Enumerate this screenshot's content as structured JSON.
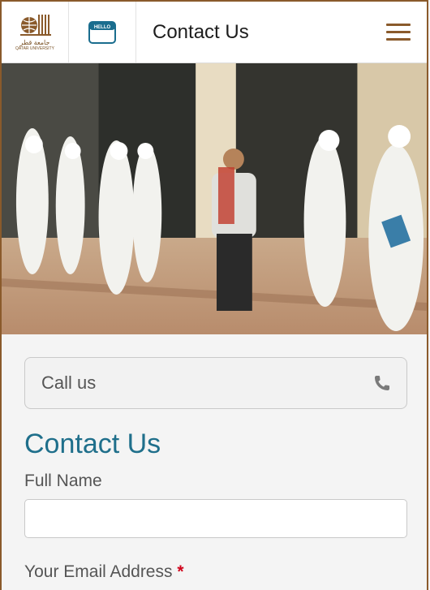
{
  "header": {
    "logo_arabic": "جامعة قطر",
    "logo_english": "QATAR UNIVERSITY",
    "hello_badge": "HELLO",
    "title": "Contact Us",
    "menu_icon": "hamburger-menu-icon"
  },
  "call": {
    "label": "Call us",
    "icon": "phone-icon"
  },
  "form": {
    "heading": "Contact Us",
    "full_name_label": "Full Name",
    "full_name_value": "",
    "email_label": "Your Email Address",
    "required_marker": "*"
  },
  "colors": {
    "brand_brown": "#8a5a2b",
    "heading_teal": "#1f6f8b",
    "required_red": "#d0021b"
  }
}
